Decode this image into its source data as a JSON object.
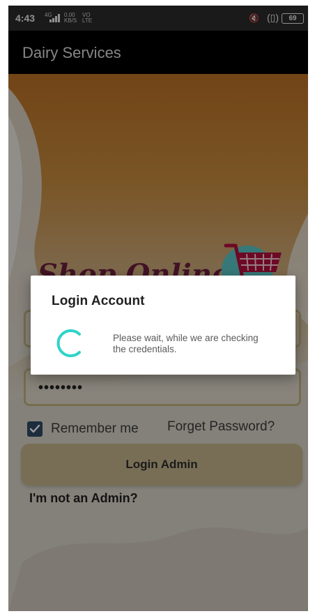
{
  "status_bar": {
    "time": "4:43",
    "network_type": "4G",
    "net_speed_value": "0.00",
    "net_speed_unit": "KB/S",
    "volte": "VO",
    "lte": "LTE",
    "battery": "69",
    "icons": [
      "signal-icon",
      "mute-icon",
      "vibrate-icon",
      "battery-icon"
    ]
  },
  "app_bar": {
    "title": "Dairy Services"
  },
  "logo": {
    "text": "Shop Online"
  },
  "form": {
    "username_value": "",
    "password_value": "••••••••",
    "remember_label": "Remember me",
    "remember_checked": true,
    "forget_label": "Forget Password?",
    "login_button": "Login Admin",
    "not_admin_link": "I'm not an Admin?"
  },
  "dialog": {
    "title": "Login Account",
    "message": "Please wait, while we are checking the credentials."
  },
  "colors": {
    "accent_spinner": "#2fd3c8",
    "checkbox": "#2f4a63",
    "button": "#c2b28a",
    "app_bar": "#000000"
  }
}
